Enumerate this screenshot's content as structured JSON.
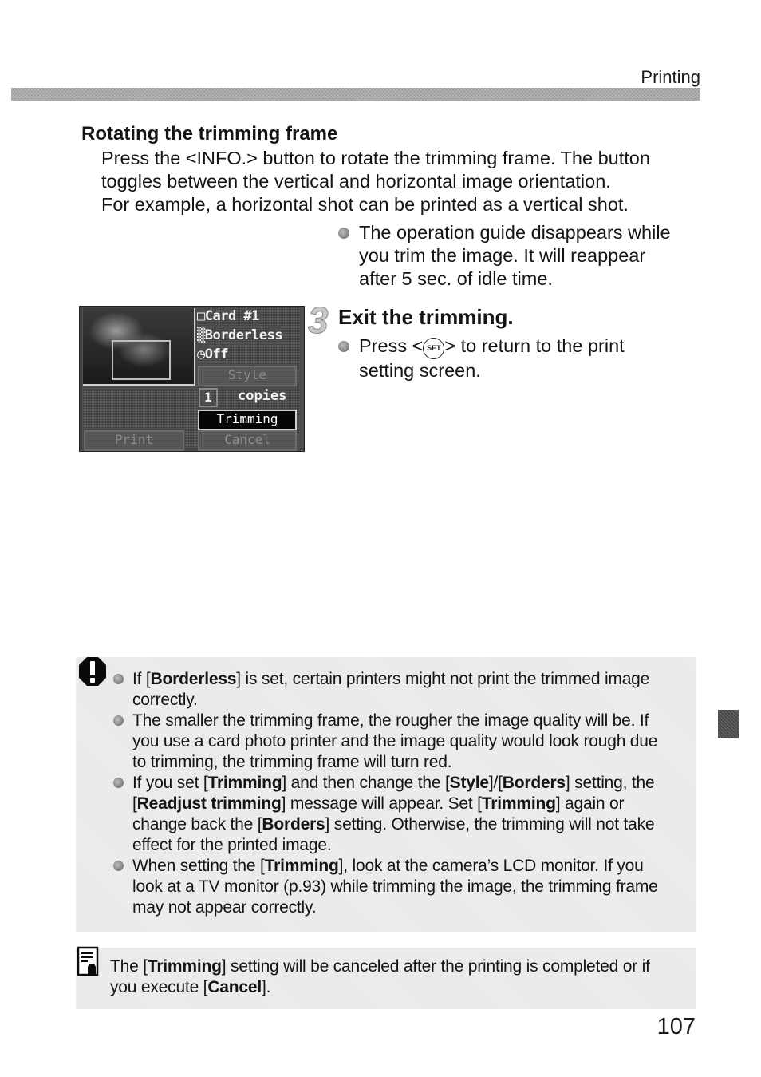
{
  "header": {
    "section": "Printing"
  },
  "intro": {
    "heading": "Rotating the trimming frame",
    "lines": [
      "Press the <INFO.> button to rotate the trimming frame. The button",
      "toggles between the vertical and horizontal image orientation.",
      "For example, a horizontal shot can be printed as a vertical shot."
    ],
    "guide_note_lines": [
      "The operation guide disappears while",
      "you trim the image. It will reappear",
      "after 5 sec. of idle time."
    ]
  },
  "lcd": {
    "card": "Card #1",
    "borders": "Borderless",
    "date": "Off",
    "style_button": "Style",
    "copies_count": "1",
    "copies_label": "copies",
    "trimming_button": "Trimming",
    "print_button": "Print",
    "cancel_button": "Cancel"
  },
  "step3": {
    "number": "3",
    "title": "Exit the trimming.",
    "line1_before": "Press <",
    "set_icon_text": "SET",
    "line1_after": "> to return to the print",
    "line2": "setting screen."
  },
  "caution": {
    "icon": "caution-icon",
    "items": [
      {
        "lines": [
          [
            {
              "t": "If ["
            },
            {
              "t": "Borderless",
              "b": true
            },
            {
              "t": "] is set, certain printers might not print the trimmed image"
            }
          ],
          [
            {
              "t": "correctly."
            }
          ]
        ]
      },
      {
        "lines": [
          [
            {
              "t": "The smaller the trimming frame, the rougher the image quality will be. If"
            }
          ],
          [
            {
              "t": "you use a card photo printer and the image quality would look rough due"
            }
          ],
          [
            {
              "t": "to trimming, the trimming frame will turn red."
            }
          ]
        ]
      },
      {
        "lines": [
          [
            {
              "t": "If you set ["
            },
            {
              "t": "Trimming",
              "b": true
            },
            {
              "t": "] and then change the ["
            },
            {
              "t": "Style",
              "b": true
            },
            {
              "t": "]/["
            },
            {
              "t": "Borders",
              "b": true
            },
            {
              "t": "] setting, the"
            }
          ],
          [
            {
              "t": "["
            },
            {
              "t": "Readjust trimming",
              "b": true
            },
            {
              "t": "] message will appear. Set ["
            },
            {
              "t": "Trimming",
              "b": true
            },
            {
              "t": "] again or"
            }
          ],
          [
            {
              "t": "change back the ["
            },
            {
              "t": "Borders",
              "b": true
            },
            {
              "t": "] setting. Otherwise, the trimming will not take"
            }
          ],
          [
            {
              "t": "effect for the printed image."
            }
          ]
        ]
      },
      {
        "lines": [
          [
            {
              "t": "When setting the ["
            },
            {
              "t": "Trimming",
              "b": true
            },
            {
              "t": "], look at the camera’s LCD monitor. If you"
            }
          ],
          [
            {
              "t": "look at a TV monitor (p.93) while trimming the image, the trimming frame"
            }
          ],
          [
            {
              "t": "may not appear correctly."
            }
          ]
        ]
      }
    ]
  },
  "memo": {
    "icon": "memo-pencil-icon",
    "lines": [
      [
        {
          "t": "The ["
        },
        {
          "t": "Trimming",
          "b": true
        },
        {
          "t": "] setting will be canceled after the printing is completed or if"
        }
      ],
      [
        {
          "t": "you execute ["
        },
        {
          "t": "Cancel",
          "b": true
        },
        {
          "t": "]."
        }
      ]
    ]
  },
  "footer": {
    "page_number": "107"
  }
}
